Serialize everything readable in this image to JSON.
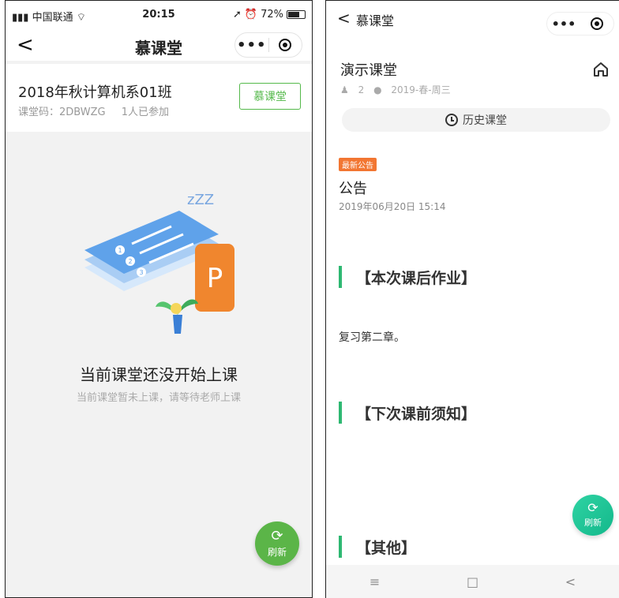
{
  "left": {
    "status": {
      "carrier": "中国联通",
      "time": "20:15",
      "battery": "72%",
      "battery_level": 0.72
    },
    "nav": {
      "title": "慕课堂",
      "back": "<",
      "menu": "•••"
    },
    "class": {
      "name": "2018年秋计算机系01班",
      "code": "课堂码：2DBWZG",
      "joined": "1人已参加",
      "button": "慕课堂"
    },
    "empty": {
      "title": "当前课堂还没开始上课",
      "subtitle": "当前课堂暂未上课，请等待老师上课",
      "zzz": "zZZ",
      "logo_letter": "P",
      "list_numbers": [
        "1",
        "2",
        "3"
      ]
    },
    "fab": {
      "label": "刷新"
    }
  },
  "right": {
    "nav": {
      "title": "慕课堂",
      "back": "<",
      "menu": "•••"
    },
    "course": {
      "title": "演示课堂",
      "students": "2",
      "term": "2019-春-周三"
    },
    "history": {
      "label": "历史课堂"
    },
    "notice": {
      "badge": "最新公告",
      "title": "公告",
      "time": "2019年06月20日 15:14"
    },
    "sections": [
      {
        "title": "【本次课后作业】",
        "body": "复习第二章。"
      },
      {
        "title": "【下次课前须知】",
        "body": ""
      },
      {
        "title": "【其他】",
        "body": ""
      }
    ],
    "fab": {
      "label": "刷新"
    },
    "android_nav": {
      "menu": "≡",
      "home": "□",
      "back": "<"
    }
  },
  "colors": {
    "green": "#55b94b",
    "teal": "#2eb872",
    "orange": "#f27632"
  },
  "icons": [
    "signal-icon",
    "wifi-icon",
    "location-icon",
    "alarm-icon",
    "battery-icon",
    "back-icon",
    "more-icon",
    "target-icon",
    "home-icon",
    "clock-icon",
    "refresh-icon",
    "person-icon"
  ]
}
